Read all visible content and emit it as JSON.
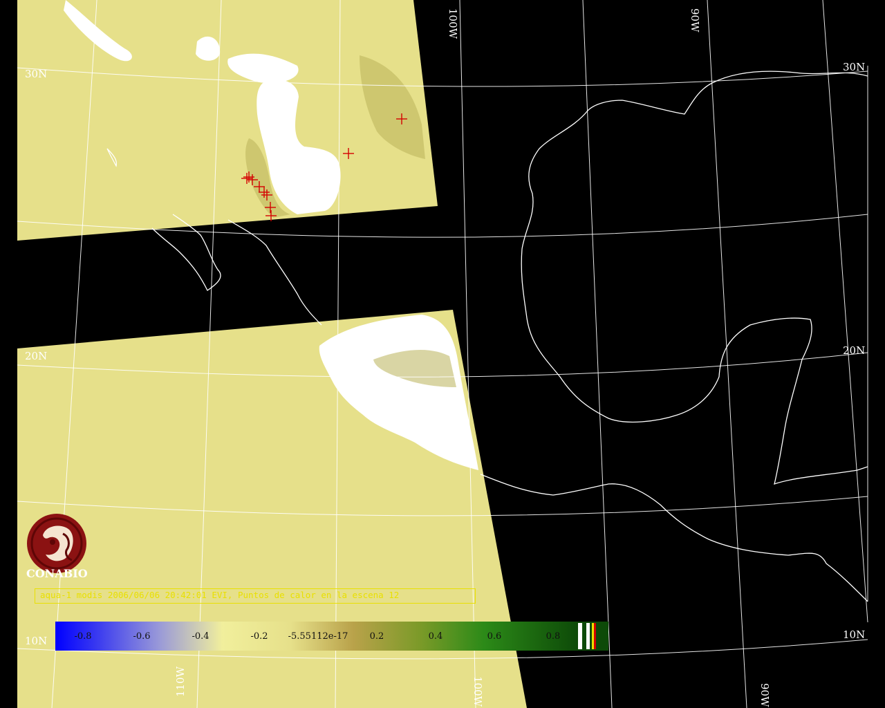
{
  "map": {
    "latitude_labels": [
      "30N",
      "20N",
      "10N",
      "30N",
      "20N",
      "10N"
    ],
    "longitude_labels": [
      "100W",
      "90W",
      "110W",
      "100W",
      "90W"
    ],
    "hotspot_count": 10,
    "colors": {
      "background": "#000000",
      "swath": "#e6e08a",
      "cloud": "#ffffff",
      "coastline": "#ffffff",
      "graticule": "#ffffff",
      "hotspot": "#d40000",
      "caption": "#e9e000"
    }
  },
  "logo": {
    "label": "CONABIO"
  },
  "caption": "aqua-1 modis 2006/06/06 20:42:01 EVI, Puntos de calor en la escena 12",
  "colorbar": {
    "ticks": [
      "-0.8",
      "-0.6",
      "-0.4",
      "-0.2",
      "-5.55112e-17",
      "0.2",
      "0.4",
      "0.6",
      "0.8"
    ],
    "tick_values": [
      -0.8,
      -0.6,
      -0.4,
      -0.2,
      -5.55112e-17,
      0.2,
      0.4,
      0.6,
      0.8
    ],
    "range": [
      -1,
      1
    ],
    "colors": [
      "#0000ff",
      "#9a9ad8",
      "#f1ef9c",
      "#e6e08a",
      "#b9a24a",
      "#7a9a28",
      "#2c8a18",
      "#0d4a08"
    ]
  }
}
